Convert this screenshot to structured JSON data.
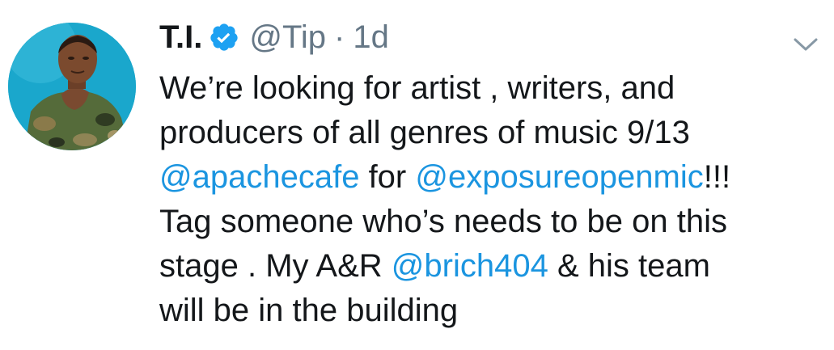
{
  "tweet": {
    "display_name": "T.I.",
    "handle": "@Tip",
    "separator": "·",
    "timestamp": "1d",
    "verified_icon": "verified-badge-icon",
    "caret_icon": "chevron-down-icon",
    "colors": {
      "text": "#14171a",
      "muted": "#657786",
      "link": "#1b95e0",
      "verified": "#1da1f2"
    },
    "lines": [
      [
        {
          "text": "We’re looking for artist , writers, and"
        }
      ],
      [
        {
          "text": "producers of all genres of music 9/13"
        }
      ],
      [
        {
          "text": "@apachecafe",
          "mention": true
        },
        {
          "text": " for "
        },
        {
          "text": "@exposureopenmic",
          "mention": true
        },
        {
          "text": "!!!"
        }
      ],
      [
        {
          "text": "Tag someone who’s needs to be on this"
        }
      ],
      [
        {
          "text": "stage . My A&R "
        },
        {
          "text": "@brich404",
          "mention": true
        },
        {
          "text": " & his team"
        }
      ],
      [
        {
          "text": "will be in the building"
        }
      ]
    ]
  }
}
